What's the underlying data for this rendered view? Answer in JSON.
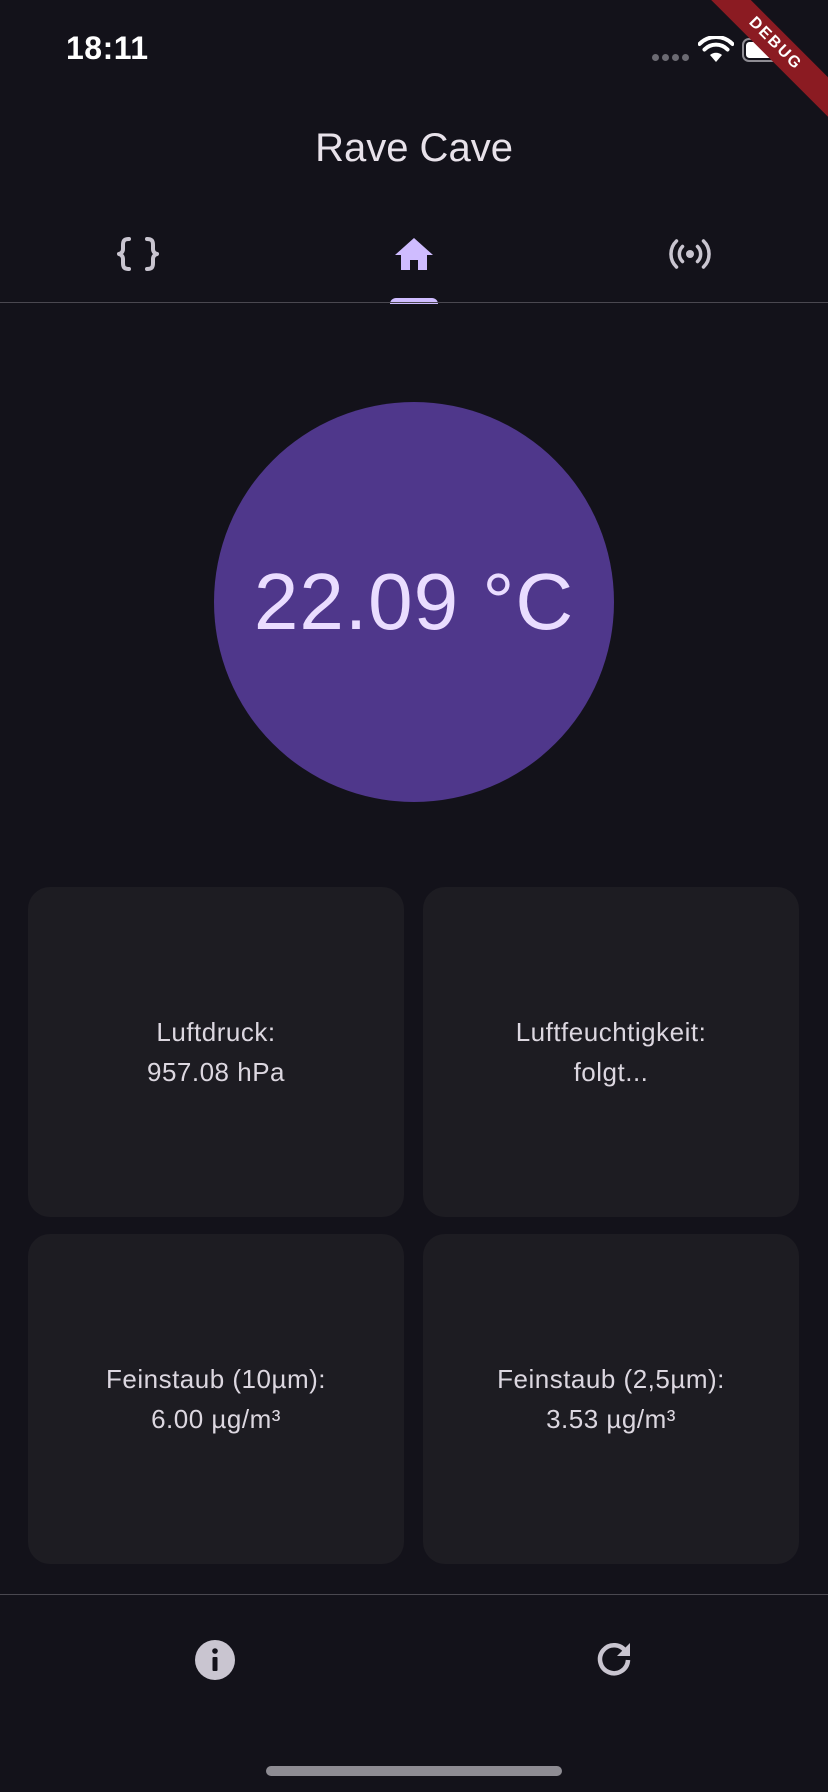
{
  "status_bar": {
    "time": "18:11"
  },
  "debug_banner": {
    "label": "DEBUG"
  },
  "app_bar": {
    "title": "Rave Cave"
  },
  "tabs": [
    {
      "icon": "data-object-icon",
      "selected": false
    },
    {
      "icon": "home-icon",
      "selected": true
    },
    {
      "icon": "sensors-icon",
      "selected": false
    }
  ],
  "temperature": {
    "value": "22.09 °C"
  },
  "cards": {
    "pressure": {
      "label": "Luftdruck:",
      "value": "957.08 hPa"
    },
    "humidity": {
      "label": "Luftfeuchtigkeit:",
      "value": "folgt..."
    },
    "pm10": {
      "label": "Feinstaub (10µm):",
      "value": "6.00 µg/m³"
    },
    "pm25": {
      "label": "Feinstaub (2,5µm):",
      "value": "3.53 µg/m³"
    }
  },
  "bottom_bar": {
    "left_icon": "info-icon",
    "right_icon": "refresh-icon"
  },
  "colors": {
    "background": "#13121a",
    "accent": "#cfbcff",
    "circle": "#4f378b",
    "card": "#1d1c22"
  }
}
